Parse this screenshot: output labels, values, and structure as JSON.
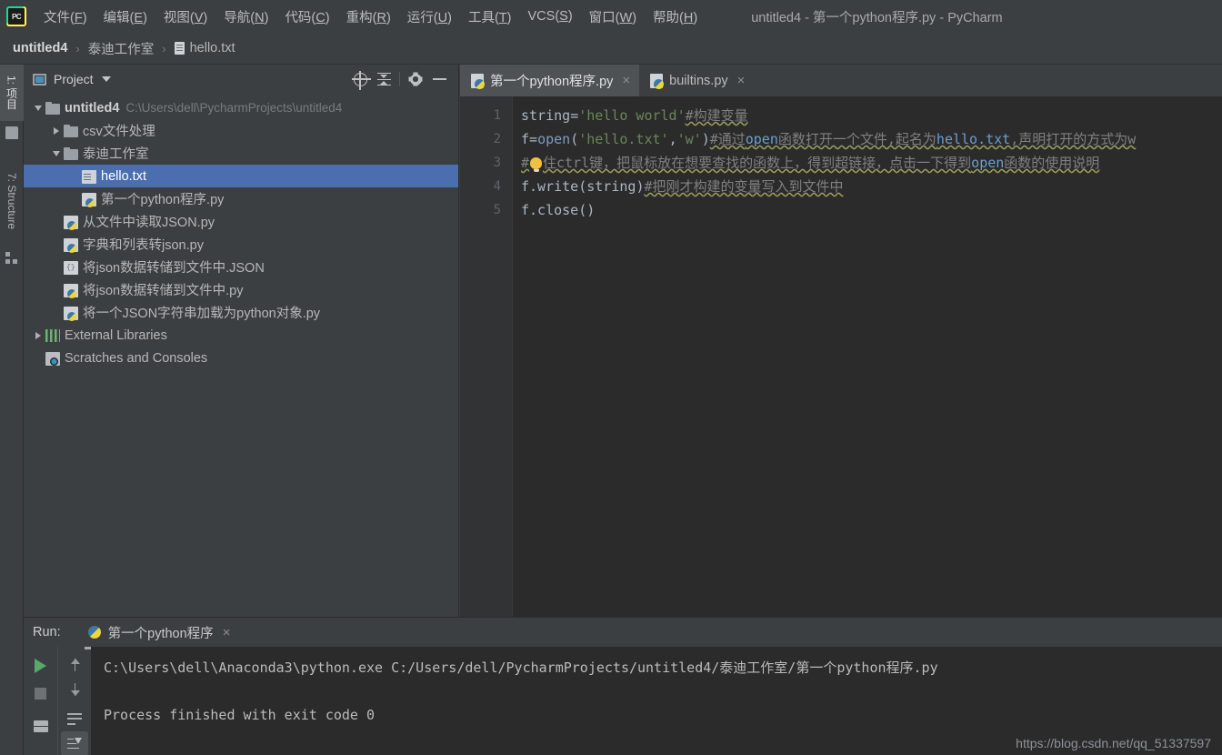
{
  "window": {
    "title": "untitled4 - 第一个python程序.py - PyCharm",
    "logo_text": "PC"
  },
  "menubar": {
    "items": [
      {
        "label": "文件(F)",
        "text": "文件(",
        "mnemonic": "F",
        "tail": ")"
      },
      {
        "label": "编辑(E)",
        "text": "编辑(",
        "mnemonic": "E",
        "tail": ")"
      },
      {
        "label": "视图(V)",
        "text": "视图(",
        "mnemonic": "V",
        "tail": ")"
      },
      {
        "label": "导航(N)",
        "text": "导航(",
        "mnemonic": "N",
        "tail": ")"
      },
      {
        "label": "代码(C)",
        "text": "代码(",
        "mnemonic": "C",
        "tail": ")"
      },
      {
        "label": "重构(R)",
        "text": "重构(",
        "mnemonic": "R",
        "tail": ")"
      },
      {
        "label": "运行(U)",
        "text": "运行(",
        "mnemonic": "U",
        "tail": ")"
      },
      {
        "label": "工具(T)",
        "text": "工具(",
        "mnemonic": "T",
        "tail": ")"
      },
      {
        "label": "VCS(S)",
        "text": "VCS(",
        "mnemonic": "S",
        "tail": ")"
      },
      {
        "label": "窗口(W)",
        "text": "窗口(",
        "mnemonic": "W",
        "tail": ")"
      },
      {
        "label": "帮助(H)",
        "text": "帮助(",
        "mnemonic": "H",
        "tail": ")"
      }
    ]
  },
  "breadcrumb": {
    "sep": "›",
    "items": [
      {
        "label": "untitled4",
        "icon": "none"
      },
      {
        "label": "泰迪工作室",
        "icon": "none"
      },
      {
        "label": "hello.txt",
        "icon": "text-file-icon"
      }
    ]
  },
  "left_strip": {
    "project_tab": "1: 项目",
    "structure_tab": "7: Structure"
  },
  "project_panel": {
    "title": "Project",
    "buttons": [
      "locate-icon",
      "collapse-all-icon",
      "settings-icon",
      "hide-icon"
    ],
    "tree": [
      {
        "label": "untitled4",
        "note": "C:\\Users\\dell\\PycharmProjects\\untitled4",
        "icon": "folder-icon",
        "arrow": "down",
        "indent": 0,
        "bold": true,
        "selected": false
      },
      {
        "label": "csv文件处理",
        "note": "",
        "icon": "folder-icon",
        "arrow": "right",
        "indent": 1,
        "bold": false,
        "selected": false
      },
      {
        "label": "泰迪工作室",
        "note": "",
        "icon": "folder-icon",
        "arrow": "down",
        "indent": 1,
        "bold": false,
        "selected": false
      },
      {
        "label": "hello.txt",
        "note": "",
        "icon": "text-file-icon",
        "arrow": "blank",
        "indent": 2,
        "bold": false,
        "selected": true
      },
      {
        "label": "第一个python程序.py",
        "note": "",
        "icon": "python-file-icon",
        "arrow": "blank",
        "indent": 2,
        "bold": false,
        "selected": false
      },
      {
        "label": "从文件中读取JSON.py",
        "note": "",
        "icon": "python-file-icon",
        "arrow": "blank",
        "indent": 1,
        "bold": false,
        "selected": false
      },
      {
        "label": "字典和列表转json.py",
        "note": "",
        "icon": "python-file-icon",
        "arrow": "blank",
        "indent": 1,
        "bold": false,
        "selected": false
      },
      {
        "label": "将json数据转储到文件中.JSON",
        "note": "",
        "icon": "json-file-icon",
        "arrow": "blank",
        "indent": 1,
        "bold": false,
        "selected": false
      },
      {
        "label": "将json数据转储到文件中.py",
        "note": "",
        "icon": "python-file-icon",
        "arrow": "blank",
        "indent": 1,
        "bold": false,
        "selected": false
      },
      {
        "label": "将一个JSON字符串加载为python对象.py",
        "note": "",
        "icon": "python-file-icon",
        "arrow": "blank",
        "indent": 1,
        "bold": false,
        "selected": false
      },
      {
        "label": "External Libraries",
        "note": "",
        "icon": "libraries-icon",
        "arrow": "right",
        "indent": 0,
        "bold": false,
        "selected": false
      },
      {
        "label": "Scratches and Consoles",
        "note": "",
        "icon": "scratches-icon",
        "arrow": "blank",
        "indent": 0,
        "bold": false,
        "selected": false
      }
    ]
  },
  "editor": {
    "tabs": [
      {
        "label": "第一个python程序.py",
        "active": true,
        "close": "×"
      },
      {
        "label": "builtins.py",
        "active": false,
        "close": "×"
      }
    ],
    "line_numbers": [
      "1",
      "2",
      "3",
      "4",
      "5"
    ],
    "lines": [
      {
        "number": "1",
        "text": "string='hello world'#构建变量",
        "tokens": [
          {
            "t": "string",
            "c": "var"
          },
          {
            "t": "=",
            "c": "var"
          },
          {
            "t": "'hello world'",
            "c": "str"
          },
          {
            "t": "#构建变量",
            "c": "cmt"
          }
        ]
      },
      {
        "number": "2",
        "text": "f=open('hello.txt','w')#通过open函数打开一个文件,起名为hello.txt,声明打开的方式为w",
        "tokens": [
          {
            "t": "f",
            "c": "var"
          },
          {
            "t": "=",
            "c": "var"
          },
          {
            "t": "open",
            "c": "fn"
          },
          {
            "t": "(",
            "c": "var"
          },
          {
            "t": "'hello.txt'",
            "c": "str"
          },
          {
            "t": ",",
            "c": "var"
          },
          {
            "t": "'w'",
            "c": "str"
          },
          {
            "t": ")",
            "c": "var"
          },
          {
            "t": "#通过",
            "c": "cmt"
          },
          {
            "t": "open",
            "c": "cmt-hl"
          },
          {
            "t": "函数打开一个文件,起名为",
            "c": "cmt"
          },
          {
            "t": "hello.txt",
            "c": "cmt-hl"
          },
          {
            "t": ",声明打开的方式为w",
            "c": "cmt"
          }
        ]
      },
      {
        "number": "3",
        "text": "#按住ctrl键，把鼠标放在想要查找的函数上，得到超链接，点击一下得到open函数的使用说明",
        "tokens": [
          {
            "t": "#",
            "c": "cmt"
          },
          {
            "t": "BULB",
            "c": "bulb"
          },
          {
            "t": "住ctrl键，把鼠标放在想要查找的函数上，得到超链接，点击一下得到",
            "c": "cmt"
          },
          {
            "t": "open",
            "c": "cmt-hl"
          },
          {
            "t": "函数的使用说明",
            "c": "cmt"
          }
        ]
      },
      {
        "number": "4",
        "text": "f.write(string)#把刚才构建的变量写入到文件中",
        "tokens": [
          {
            "t": "f.write",
            "c": "var"
          },
          {
            "t": "(",
            "c": "var"
          },
          {
            "t": "string",
            "c": "var"
          },
          {
            "t": ")",
            "c": "var"
          },
          {
            "t": "#把刚才构建的变量写入到文件中",
            "c": "cmt"
          }
        ]
      },
      {
        "number": "5",
        "text": "f.close()",
        "tokens": [
          {
            "t": "f.close()",
            "c": "var"
          }
        ]
      }
    ]
  },
  "run_window": {
    "label": "Run:",
    "tab_label": "第一个python程序",
    "tab_close": "×",
    "toolbar_left": [
      "run-icon",
      "stop-icon",
      "layout-icon"
    ],
    "toolbar_right": [
      "arrow-up-icon",
      "arrow-down-icon",
      "soft-wrap-icon",
      "sort-icon"
    ],
    "console_lines": [
      "C:\\Users\\dell\\Anaconda3\\python.exe C:/Users/dell/PycharmProjects/untitled4/泰迪工作室/第一个python程序.py",
      "",
      "Process finished with exit code 0"
    ]
  },
  "watermark": "https://blog.csdn.net/qq_51337597",
  "colors": {
    "background": "#3c3f41",
    "editor_bg": "#2b2b2b",
    "selection": "#4b6eaf",
    "accent_green": "#59a869",
    "string": "#6a8759",
    "keyword": "#cc7832",
    "comment": "#808080",
    "link": "#6a9fcf"
  }
}
